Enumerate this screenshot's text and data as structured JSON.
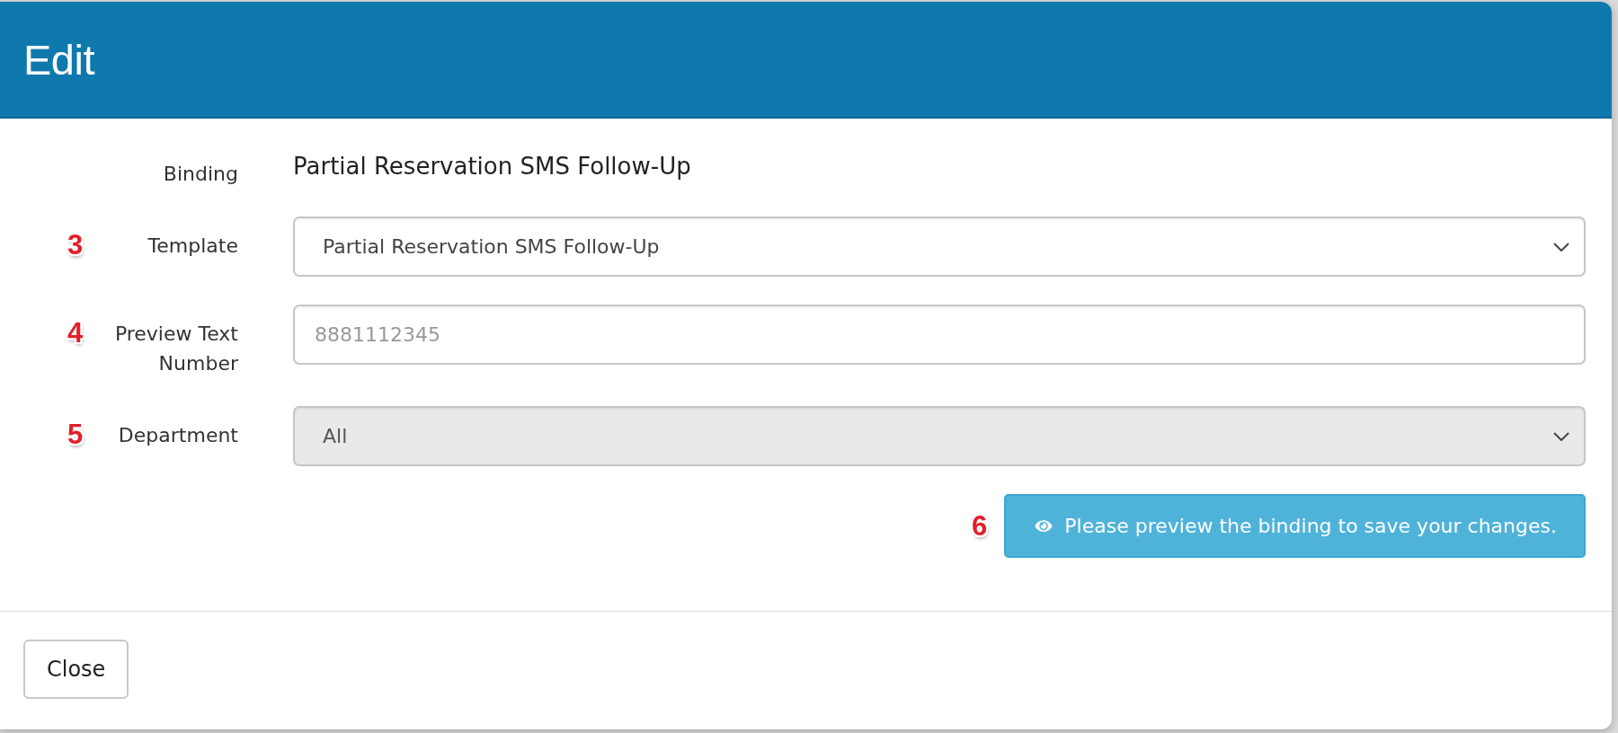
{
  "modal": {
    "title": "Edit",
    "fields": [
      {
        "kind": "static",
        "label": "Binding",
        "value": "Partial Reservation SMS Follow-Up"
      },
      {
        "kind": "select",
        "marker": "3",
        "label": "Template",
        "value": "Partial Reservation SMS Follow-Up",
        "disabled": false
      },
      {
        "kind": "input",
        "marker": "4",
        "label": "Preview Text Number",
        "placeholder": "8881112345"
      },
      {
        "kind": "select",
        "marker": "5",
        "label": "Department",
        "value": "All",
        "disabled": true
      }
    ],
    "action": {
      "marker": "6",
      "label": "Please preview the binding to save your changes."
    },
    "footer": {
      "buttons": [
        "Close"
      ]
    }
  }
}
